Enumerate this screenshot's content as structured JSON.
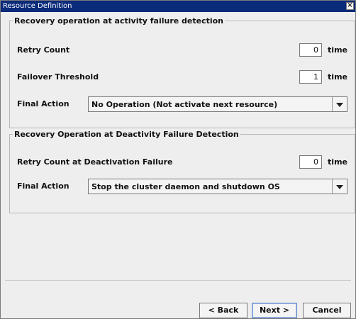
{
  "window": {
    "title": "Resource Definition",
    "close_label": "×"
  },
  "activation": {
    "legend": "Recovery operation at activity failure detection",
    "retry_label": "Retry Count",
    "retry_value": "0",
    "retry_unit": "time",
    "failover_label": "Failover Threshold",
    "failover_value": "1",
    "failover_unit": "time",
    "final_action_label": "Final Action",
    "final_action_value": "No Operation (Not activate next resource)"
  },
  "deactivation": {
    "legend": "Recovery Operation at Deactivity Failure Detection",
    "retry_label": "Retry Count at Deactivation Failure",
    "retry_value": "0",
    "retry_unit": "time",
    "final_action_label": "Final Action",
    "final_action_value": "Stop the cluster daemon and shutdown OS"
  },
  "buttons": {
    "back": "< Back",
    "next": "Next >",
    "cancel": "Cancel"
  }
}
